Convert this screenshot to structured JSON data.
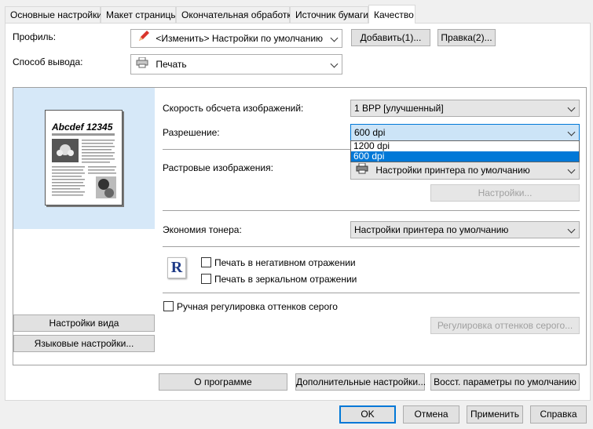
{
  "tabs": [
    "Основные настройки",
    "Макет страницы",
    "Окончательная обработка",
    "Источник бумаги",
    "Качество"
  ],
  "active_tab": "Качество",
  "profile": {
    "label": "Профиль:",
    "value": "<Изменить> Настройки по умолчанию",
    "add_button": "Добавить(1)...",
    "edit_button": "Правка(2)..."
  },
  "output_method": {
    "label": "Способ вывода:",
    "value": "Печать"
  },
  "preview": {
    "title": "Abcdef 12345"
  },
  "left_buttons": {
    "view_settings": "Настройки вида",
    "language_settings": "Языковые настройки..."
  },
  "quality": {
    "image_processing_label": "Скорость обсчета изображений:",
    "image_processing_value": "1 BPP [улучшенный]",
    "resolution_label": "Разрешение:",
    "resolution_value": "600 dpi",
    "resolution_options": [
      "1200 dpi",
      "600 dpi"
    ],
    "raster_label": "Растровые изображения:",
    "raster_value": "Настройки принтера по умолчанию",
    "raster_settings_button": "Настройки...",
    "toner_label": "Экономия тонера:",
    "toner_value": "Настройки принтера по умолчанию",
    "negative_label": "Печать в негативном отражении",
    "mirror_label": "Печать в зеркальном отражении",
    "r_icon": "R",
    "gray_manual_label": "Ручная регулировка оттенков серого",
    "gray_button": "Регулировка оттенков серого..."
  },
  "bottom_panel_buttons": {
    "about": "О программе",
    "advanced": "Дополнительные настройки...",
    "restore": "Восст. параметры по умолчанию"
  },
  "dialog_buttons": {
    "ok": "OK",
    "cancel": "Отмена",
    "apply": "Применить",
    "help": "Справка"
  }
}
